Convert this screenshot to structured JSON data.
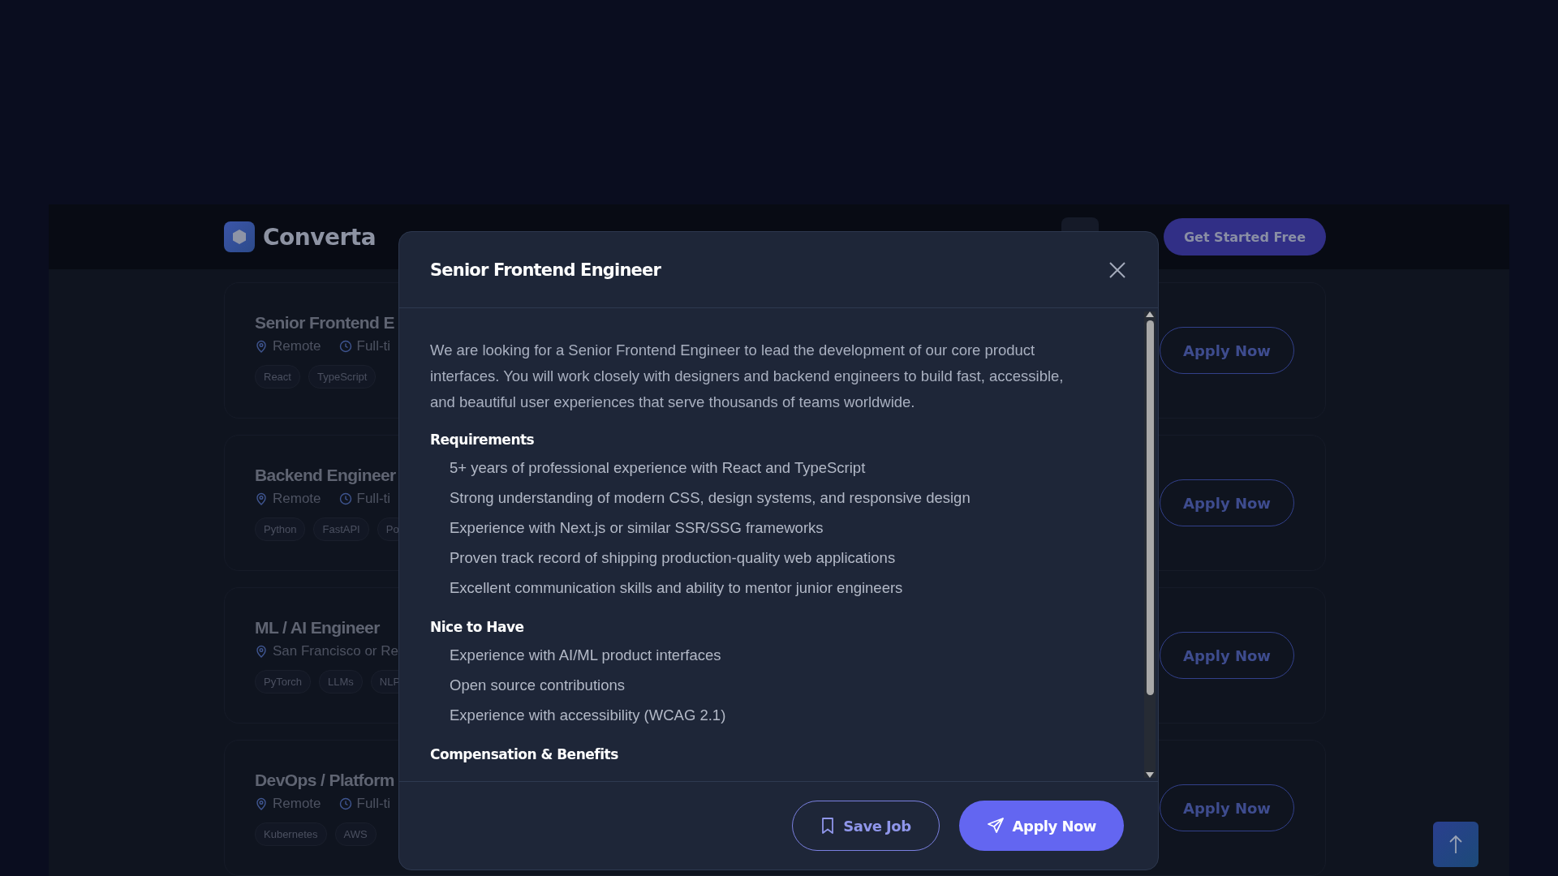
{
  "header": {
    "logo": "Converta",
    "cta": "Get Started Free"
  },
  "jobs": [
    {
      "title": "Senior Frontend E",
      "location": "Remote",
      "type": "Full-ti",
      "tags": [
        "React",
        "TypeScript"
      ],
      "action": "Apply Now"
    },
    {
      "title": "Backend Engineer",
      "location": "Remote",
      "type": "Full-ti",
      "tags": [
        "Python",
        "FastAPI",
        "Po"
      ],
      "action": "Apply Now"
    },
    {
      "title": "ML / AI Engineer",
      "location": "San Francisco or Re",
      "tags": [
        "PyTorch",
        "LLMs",
        "NLP"
      ],
      "action": "Apply Now"
    },
    {
      "title": "DevOps / Platform",
      "location": "Remote",
      "type": "Full-ti",
      "tags": [
        "Kubernetes",
        "AWS"
      ],
      "action": "Apply Now"
    }
  ],
  "modal": {
    "title": "Senior Frontend Engineer",
    "description": "We are looking for a Senior Frontend Engineer to lead the development of our core product interfaces. You will work closely with designers and backend engineers to build fast, accessible, and beautiful user experiences that serve thousands of teams worldwide.",
    "sections": [
      {
        "heading": "Requirements",
        "items": [
          "5+ years of professional experience with React and TypeScript",
          "Strong understanding of modern CSS, design systems, and responsive design",
          "Experience with Next.js or similar SSR/SSG frameworks",
          "Proven track record of shipping production-quality web applications",
          "Excellent communication skills and ability to mentor junior engineers"
        ]
      },
      {
        "heading": "Nice to Have",
        "items": [
          "Experience with AI/ML product interfaces",
          "Open source contributions",
          "Experience with accessibility (WCAG 2.1)"
        ]
      },
      {
        "heading": "Compensation & Benefits"
      }
    ],
    "buttons": [
      {
        "kind": "outline",
        "label": "Save Job"
      },
      {
        "kind": "primary",
        "label": "Apply Now"
      }
    ]
  }
}
